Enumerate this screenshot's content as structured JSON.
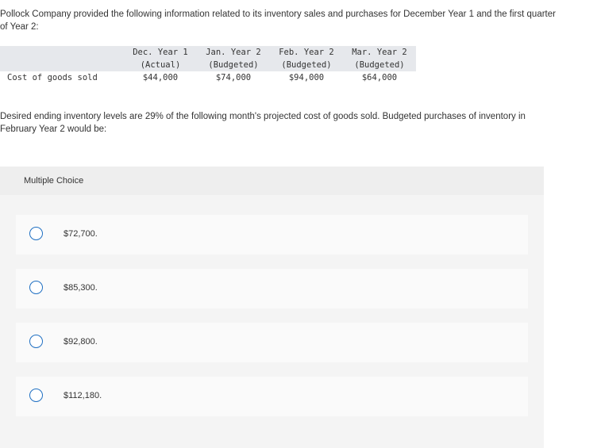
{
  "question": {
    "intro": "Pollock Company provided the following information related to its inventory sales and purchases for December Year 1 and the first quarter of Year 2:",
    "prompt": "Desired ending inventory levels are 29% of the following month's projected cost of goods sold. Budgeted purchases of inventory in February Year 2 would be:"
  },
  "table": {
    "columns": [
      {
        "line1": "Dec. Year 1",
        "line2": "(Actual)"
      },
      {
        "line1": "Jan. Year 2",
        "line2": "(Budgeted)"
      },
      {
        "line1": "Feb. Year 2",
        "line2": "(Budgeted)"
      },
      {
        "line1": "Mar. Year 2",
        "line2": "(Budgeted)"
      }
    ],
    "row": {
      "label": "Cost of goods sold",
      "values": [
        "$44,000",
        "$74,000",
        "$94,000",
        "$64,000"
      ]
    }
  },
  "multiple_choice": {
    "title": "Multiple Choice",
    "options": [
      "$72,700.",
      "$85,300.",
      "$92,800.",
      "$112,180."
    ]
  },
  "colors": {
    "table_header_bg": "#e6e8ec",
    "radio_border": "#1f6fc2",
    "panel_bg": "#f4f4f4"
  }
}
